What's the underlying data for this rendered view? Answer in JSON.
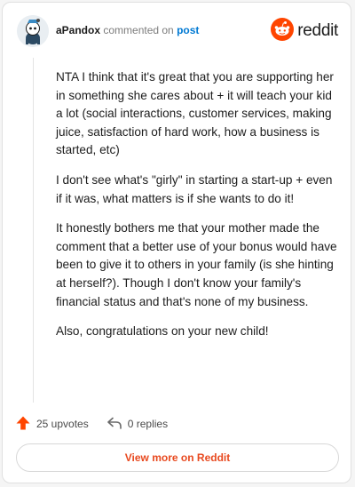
{
  "header": {
    "username": "aPandox",
    "action_text": " commented on ",
    "post_link": "post",
    "brand_name": "reddit"
  },
  "comment": {
    "paragraphs": [
      "NTA I think that it's great that you are supporting her in something she cares about + it will teach your kid a lot (social interactions, customer services, making juice, satisfaction of hard work, how a business is started, etc)",
      "I don't see what's \"girly\" in starting a start-up + even if it was, what matters is if she wants to do it!",
      "It honestly bothers me that your mother made the comment that a better use of your bonus would have been to give it to others in your family (is she hinting at herself?). Though I don't know your family's financial status and that's none of my business.",
      "Also, congratulations on your new child!"
    ]
  },
  "actions": {
    "upvotes": "25 upvotes",
    "replies": "0 replies"
  },
  "footer": {
    "view_more": "View more on Reddit"
  },
  "colors": {
    "brand": "#ff4500",
    "link": "#0079d3",
    "cta": "#e8491f"
  },
  "icons": {
    "avatar": "snoo-avatar-icon",
    "brand": "reddit-logo-icon",
    "upvote": "upvote-arrow-icon",
    "reply": "reply-arrow-icon"
  }
}
